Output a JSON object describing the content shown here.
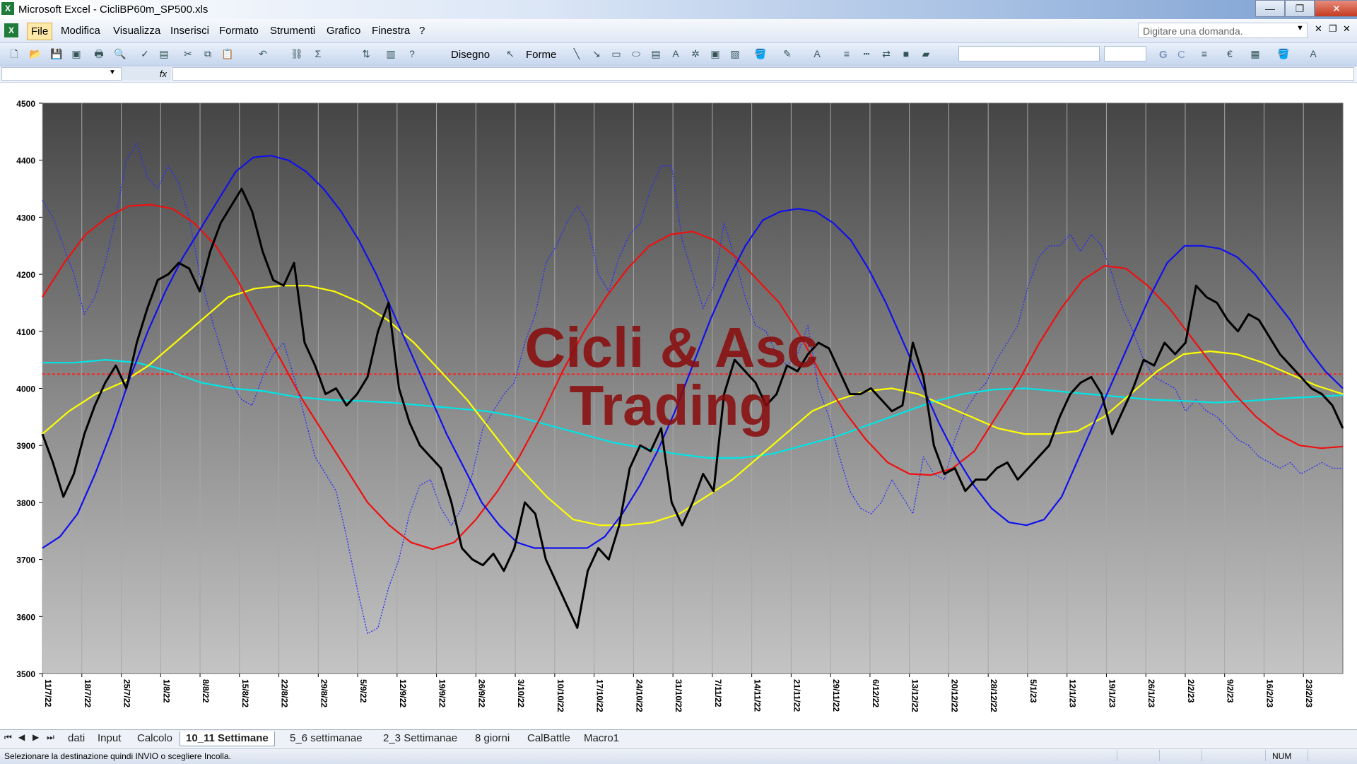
{
  "window": {
    "title": "Microsoft Excel - CicliBP60m_SP500.xls",
    "minimize": "—",
    "restore": "❐",
    "close": "✕"
  },
  "menu": {
    "items": [
      "File",
      "Modifica",
      "Visualizza",
      "Inserisci",
      "Formato",
      "Strumenti",
      "Grafico",
      "Finestra",
      "?"
    ],
    "help_placeholder": "Digitare una domanda."
  },
  "toolbar": {
    "drawing_label": "Disegno",
    "shapes_label": "Forme",
    "bold": "G",
    "italic": "C"
  },
  "chart_data": {
    "type": "line",
    "watermark": [
      "Cicli & Asc",
      "Trading"
    ],
    "ylim": [
      3500,
      4500
    ],
    "yticks": [
      3500,
      3600,
      3700,
      3800,
      3900,
      4000,
      4100,
      4200,
      4300,
      4400,
      4500
    ],
    "x_categories": [
      "11/7/22",
      "18/7/22",
      "25/7/22",
      "1/8/22",
      "8/8/22",
      "15/8/22",
      "22/8/22",
      "29/8/22",
      "5/9/22",
      "12/9/22",
      "19/9/22",
      "26/9/22",
      "3/10/22",
      "10/10/22",
      "17/10/22",
      "24/10/22",
      "31/10/22",
      "7/11/22",
      "14/11/22",
      "21/11/22",
      "29/11/22",
      "6/12/22",
      "13/12/22",
      "20/12/22",
      "28/12/22",
      "5/1/23",
      "12/1/23",
      "19/1/23",
      "26/1/23",
      "2/2/23",
      "9/2/23",
      "16/2/23",
      "23/2/23"
    ],
    "reference_line": 4025,
    "colors": {
      "price": "#000000",
      "dotted": "#2a2aff",
      "blue": "#1010ee",
      "red": "#ee1010",
      "yellow": "#ffff00",
      "cyan": "#00e5e5",
      "reference": "#ff2020"
    },
    "series": [
      {
        "key": "price",
        "values": [
          3920,
          3870,
          3810,
          3850,
          3920,
          3970,
          4010,
          4040,
          4000,
          4080,
          4140,
          4190,
          4200,
          4220,
          4210,
          4170,
          4240,
          4290,
          4320,
          4350,
          4310,
          4240,
          4190,
          4180,
          4220,
          4080,
          4040,
          3990,
          4000,
          3970,
          3990,
          4020,
          4100,
          4150,
          4000,
          3940,
          3900,
          3880,
          3860,
          3800,
          3720,
          3700,
          3690,
          3710,
          3680,
          3720,
          3800,
          3780,
          3700,
          3660,
          3620,
          3580,
          3680,
          3720,
          3700,
          3760,
          3860,
          3900,
          3890,
          3930,
          3800,
          3760,
          3800,
          3850,
          3820,
          3990,
          4050,
          4030,
          4010,
          3970,
          3990,
          4040,
          4030,
          4060,
          4080,
          4070,
          4030,
          3990,
          3990,
          4000,
          3980,
          3960,
          3970,
          4080,
          4020,
          3900,
          3850,
          3860,
          3820,
          3840,
          3840,
          3860,
          3870,
          3840,
          3860,
          3880,
          3900,
          3950,
          3990,
          4010,
          4020,
          3990,
          3920,
          3960,
          4000,
          4050,
          4040,
          4080,
          4060,
          4080,
          4180,
          4160,
          4150,
          4120,
          4100,
          4130,
          4120,
          4090,
          4060,
          4040,
          4020,
          4000,
          3990,
          3970,
          3930
        ]
      },
      {
        "key": "dotted",
        "values": [
          4330,
          4300,
          4250,
          4200,
          4130,
          4160,
          4220,
          4300,
          4400,
          4430,
          4370,
          4350,
          4390,
          4360,
          4300,
          4200,
          4130,
          4070,
          4010,
          3980,
          3970,
          4020,
          4060,
          4080,
          4020,
          3950,
          3880,
          3850,
          3820,
          3740,
          3650,
          3570,
          3580,
          3650,
          3700,
          3780,
          3830,
          3840,
          3790,
          3760,
          3790,
          3850,
          3930,
          3960,
          3990,
          4010,
          4080,
          4130,
          4220,
          4250,
          4290,
          4320,
          4290,
          4200,
          4170,
          4230,
          4270,
          4290,
          4350,
          4390,
          4390,
          4260,
          4200,
          4140,
          4180,
          4290,
          4230,
          4160,
          4110,
          4100,
          4060,
          4040,
          4060,
          4110,
          4000,
          3950,
          3880,
          3820,
          3790,
          3780,
          3800,
          3840,
          3810,
          3780,
          3880,
          3850,
          3840,
          3910,
          3960,
          3990,
          4010,
          4050,
          4080,
          4110,
          4180,
          4230,
          4250,
          4250,
          4270,
          4240,
          4270,
          4250,
          4200,
          4140,
          4100,
          4050,
          4020,
          4010,
          4000,
          3960,
          3980,
          3960,
          3950,
          3930,
          3910,
          3900,
          3880,
          3870,
          3860,
          3870,
          3850,
          3860,
          3870,
          3860,
          3860
        ]
      },
      {
        "key": "blue",
        "values": [
          3720,
          3740,
          3780,
          3850,
          3930,
          4020,
          4100,
          4170,
          4230,
          4280,
          4330,
          4380,
          4405,
          4408,
          4400,
          4380,
          4350,
          4310,
          4260,
          4200,
          4130,
          4060,
          3990,
          3920,
          3860,
          3800,
          3760,
          3730,
          3720,
          3720,
          3720,
          3720,
          3740,
          3780,
          3830,
          3890,
          3960,
          4040,
          4120,
          4190,
          4250,
          4295,
          4310,
          4315,
          4310,
          4290,
          4260,
          4210,
          4150,
          4080,
          4010,
          3940,
          3880,
          3830,
          3790,
          3765,
          3760,
          3770,
          3810,
          3880,
          3950,
          4020,
          4090,
          4160,
          4220,
          4250,
          4250,
          4245,
          4230,
          4200,
          4160,
          4120,
          4070,
          4030,
          4000
        ]
      },
      {
        "key": "red",
        "values": [
          4160,
          4220,
          4270,
          4300,
          4320,
          4322,
          4315,
          4290,
          4250,
          4190,
          4120,
          4050,
          3980,
          3920,
          3860,
          3800,
          3760,
          3730,
          3718,
          3730,
          3770,
          3820,
          3880,
          3950,
          4030,
          4100,
          4160,
          4210,
          4250,
          4270,
          4275,
          4260,
          4230,
          4190,
          4150,
          4090,
          4020,
          3960,
          3910,
          3870,
          3850,
          3848,
          3860,
          3890,
          3950,
          4010,
          4080,
          4140,
          4190,
          4215,
          4210,
          4180,
          4140,
          4090,
          4040,
          3990,
          3950,
          3920,
          3900,
          3895,
          3898
        ]
      },
      {
        "key": "yellow",
        "values": [
          3920,
          3960,
          3990,
          4010,
          4040,
          4080,
          4120,
          4160,
          4175,
          4180,
          4180,
          4170,
          4150,
          4120,
          4080,
          4030,
          3980,
          3920,
          3860,
          3810,
          3770,
          3760,
          3760,
          3765,
          3780,
          3810,
          3840,
          3880,
          3920,
          3960,
          3980,
          3995,
          4000,
          3990,
          3970,
          3950,
          3930,
          3920,
          3920,
          3925,
          3950,
          3990,
          4030,
          4060,
          4065,
          4060,
          4045,
          4025,
          4005,
          3990
        ]
      },
      {
        "key": "cyan",
        "values": [
          4045,
          4045,
          4050,
          4045,
          4030,
          4010,
          4000,
          3995,
          3985,
          3980,
          3978,
          3975,
          3970,
          3965,
          3960,
          3950,
          3935,
          3920,
          3905,
          3895,
          3885,
          3878,
          3878,
          3885,
          3900,
          3915,
          3935,
          3955,
          3975,
          3990,
          3998,
          4000,
          3995,
          3990,
          3985,
          3980,
          3978,
          3975,
          3978,
          3982,
          3985,
          3988
        ]
      }
    ]
  },
  "sheets": {
    "tabs": [
      "dati",
      "Input",
      "Calcolo",
      "10_11 Settimane",
      "5_6 settimanae",
      "2_3 Settimanae",
      "8 giorni",
      "CalBattle",
      "Macro1"
    ],
    "active_index": 3
  },
  "status": {
    "message": "Selezionare la destinazione quindi INVIO o scegliere Incolla.",
    "num": "NUM"
  }
}
